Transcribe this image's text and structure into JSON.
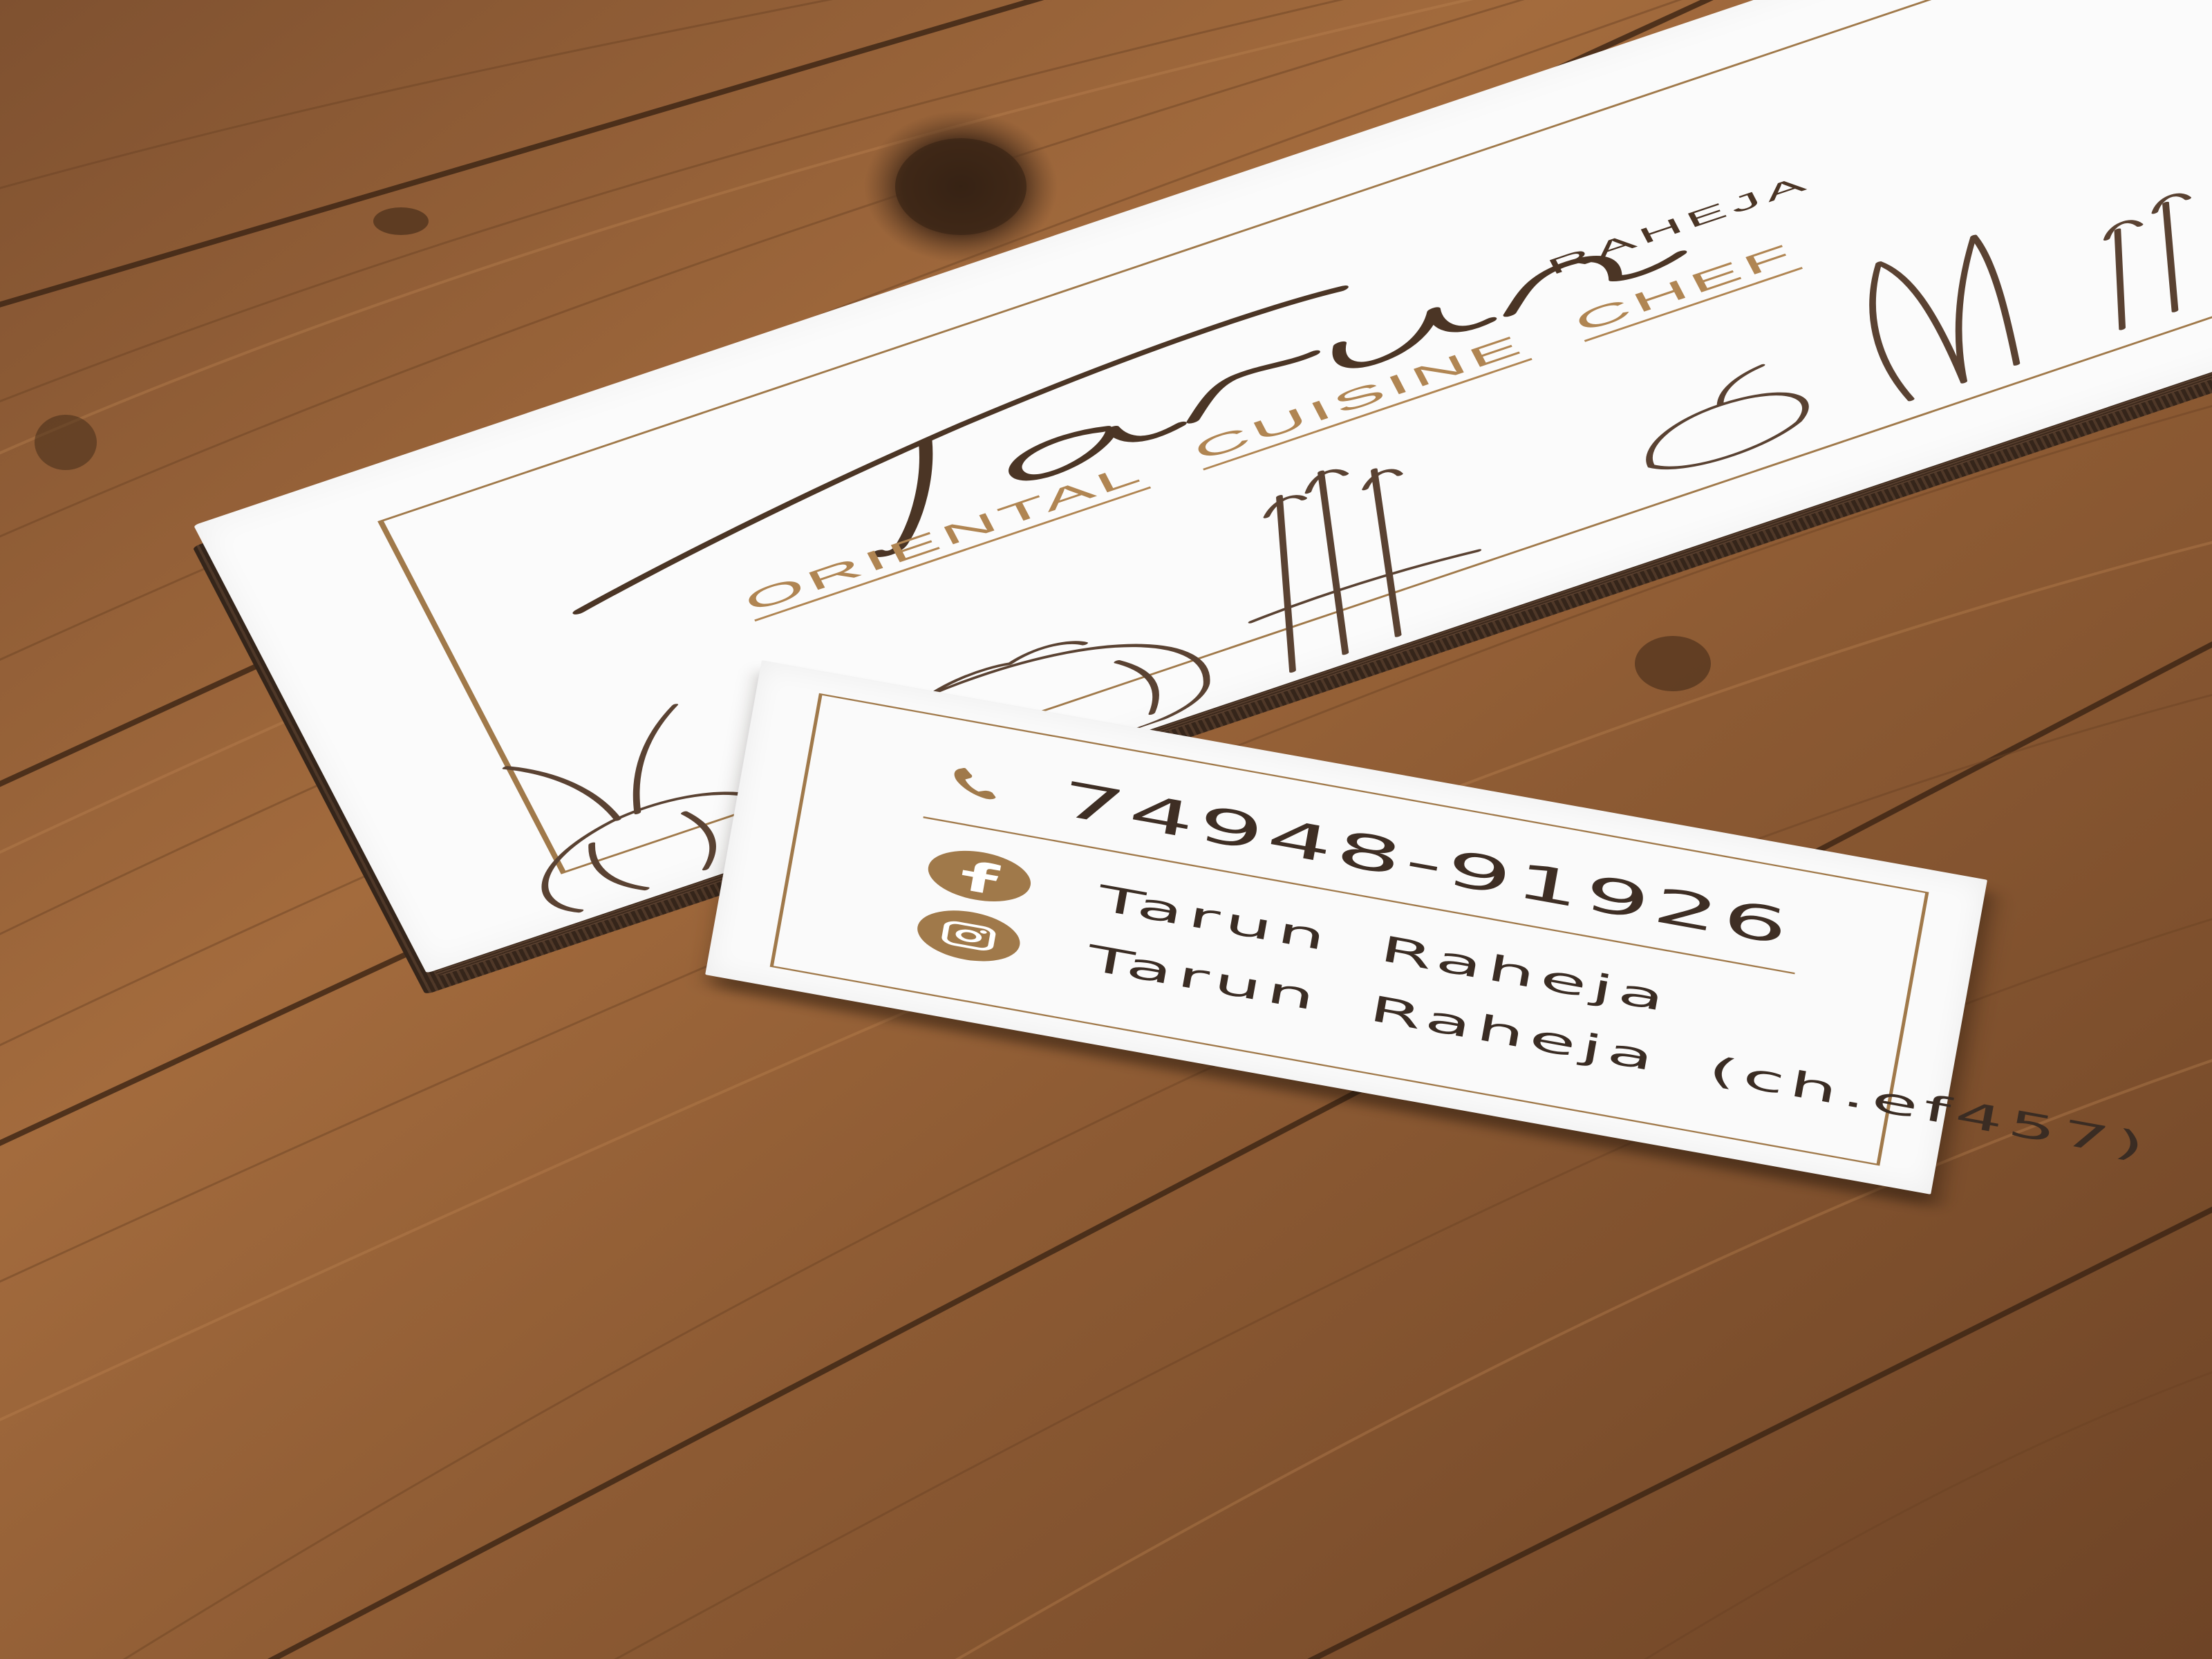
{
  "back_card": {
    "logo_first_name": "Tarun",
    "logo_surname": "RAHEJA",
    "tagline": [
      "ORIENTAL",
      "CUISINE",
      "CHEF"
    ]
  },
  "front_card": {
    "phone_icon": "phone-handset-icon",
    "phone": "74948-91926",
    "facebook_icon": "facebook-icon",
    "facebook": "Tarun  Raheja",
    "instagram_icon": "instagram-icon",
    "instagram": "Tarun  Raheja  (ch.ef457)"
  },
  "colors": {
    "accent": "#a0794a",
    "text": "#3e2e24",
    "wood": "#9a6436",
    "card": "#fafafa"
  }
}
